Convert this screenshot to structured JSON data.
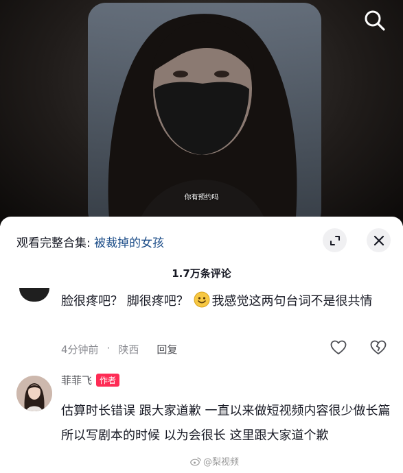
{
  "video": {
    "subtitle": "你有预约吗",
    "search_icon": "search-icon"
  },
  "sheet": {
    "collection_prefix": "观看完整合集: ",
    "collection_name": "被裁掉的女孩",
    "expand_icon": "expand-icon",
    "close_icon": "close-icon",
    "comment_count": "1.7万条评论"
  },
  "comments": [
    {
      "text_before_emoji": "脸很疼吧？ 脚很疼吧？ ",
      "emoji": "smile-emoji",
      "text_after_emoji": "我感觉这两句台词不是很共情",
      "time": "4分钟前",
      "location": "陕西",
      "reply_label": "回复"
    },
    {
      "nickname": "菲菲飞",
      "badge": "作者",
      "text": "估算时长错误 跟大家道歉 一直以来做短视频内容很少做长篇 所以写剧本的时候 以为会很长 这里跟大家道个歉"
    }
  ],
  "watermark": "@梨视频",
  "colors": {
    "accent_link": "#1d4e89",
    "badge": "#fe2c55",
    "meta_text": "#8a8b91"
  }
}
